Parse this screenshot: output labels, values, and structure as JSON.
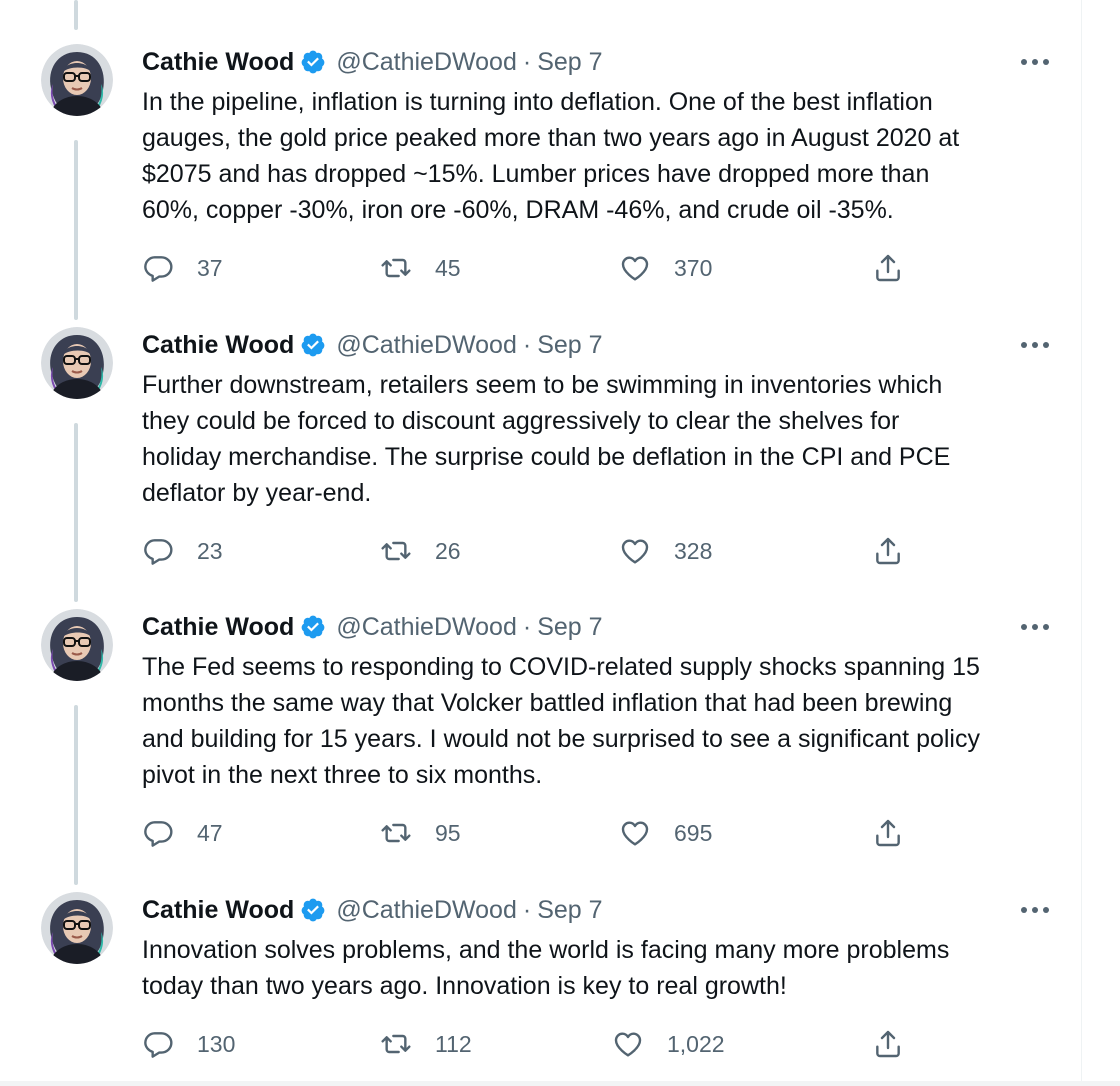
{
  "tweets": [
    {
      "name": "Cathie Wood",
      "handle": "@CathieDWood",
      "separator": "·",
      "date": "Sep 7",
      "text": "In the pipeline, inflation is turning into deflation. One of the best inflation\ngauges, the gold price peaked more than two years ago in August 2020 at\n$2075 and has dropped ~15%. Lumber prices have dropped more than\n60%, copper -30%, iron ore -60%, DRAM -46%, and crude oil -35%.",
      "replies": "37",
      "retweets": "45",
      "likes": "370"
    },
    {
      "name": "Cathie Wood",
      "handle": "@CathieDWood",
      "separator": "·",
      "date": "Sep 7",
      "text": "Further downstream, retailers seem to be swimming in inventories which\nthey could be forced to discount aggressively to clear the shelves for\nholiday merchandise. The surprise could be deflation in the CPI and PCE\ndeflator by year-end.",
      "replies": "23",
      "retweets": "26",
      "likes": "328"
    },
    {
      "name": "Cathie Wood",
      "handle": "@CathieDWood",
      "separator": "·",
      "date": "Sep 7",
      "text": "The Fed seems to responding to COVID-related supply shocks spanning 15\nmonths the same way that Volcker battled inflation that had been brewing\nand building for 15 years. I would not be surprised to see a significant policy\npivot in the next three to six months.",
      "replies": "47",
      "retweets": "95",
      "likes": "695"
    },
    {
      "name": "Cathie Wood",
      "handle": "@CathieDWood",
      "separator": "·",
      "date": "Sep 7",
      "text": "Innovation solves problems, and the world is facing many more problems\ntoday than two years ago. Innovation is key to real growth!",
      "replies": "130",
      "retweets": "112",
      "likes": "1,022"
    }
  ],
  "icons": {
    "verified": "verified-badge-icon",
    "more": "more-icon",
    "reply": "reply-icon",
    "retweet": "retweet-icon",
    "like": "like-icon",
    "share": "share-icon"
  },
  "colors": {
    "text": "#0f1419",
    "secondary": "#536471",
    "verified": "#1d9bf0",
    "thread_line": "#cfd9de"
  }
}
